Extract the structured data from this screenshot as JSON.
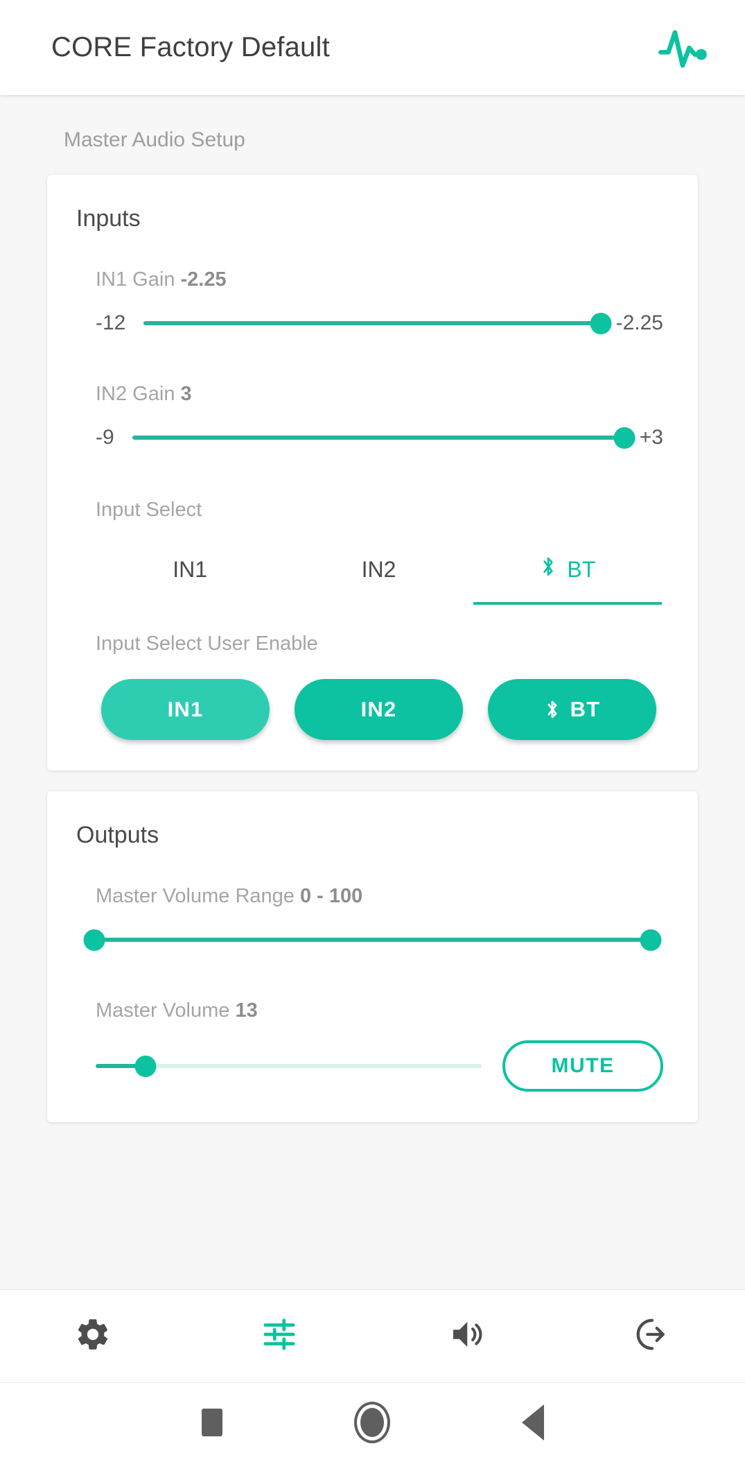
{
  "appbar": {
    "title": "CORE Factory Default",
    "status_icon": "pulse-waveform-icon"
  },
  "page": {
    "section_label": "Master Audio Setup"
  },
  "inputs_card": {
    "title": "Inputs",
    "in1_gain": {
      "label": "IN1 Gain",
      "value": "-2.25",
      "min_label": "-12",
      "max_label": "-2.25",
      "min": -12,
      "max": -2.25,
      "current": -2.25,
      "fill_percent": 100
    },
    "in2_gain": {
      "label": "IN2 Gain",
      "value": "3",
      "min_label": "-9",
      "max_label": "+3",
      "min": -9,
      "max": 3,
      "current": 3,
      "fill_percent": 100
    },
    "input_select": {
      "label": "Input Select",
      "tabs": [
        {
          "label": "IN1",
          "icon": "",
          "active": false
        },
        {
          "label": "IN2",
          "icon": "",
          "active": false
        },
        {
          "label": "BT",
          "icon": "bluetooth-icon",
          "active": true
        }
      ],
      "selected": "BT"
    },
    "input_select_user_enable": {
      "label": "Input Select User Enable",
      "buttons": [
        {
          "label": "IN1",
          "icon": "",
          "highlighted": true
        },
        {
          "label": "IN2",
          "icon": "",
          "highlighted": false
        },
        {
          "label": "BT",
          "icon": "bluetooth-icon",
          "highlighted": false
        }
      ]
    }
  },
  "outputs_card": {
    "title": "Outputs",
    "master_volume_range": {
      "label": "Master Volume Range",
      "value": "0 - 100",
      "min": 0,
      "max": 100,
      "low": 0,
      "high": 100,
      "low_percent": 0,
      "high_percent": 100
    },
    "master_volume": {
      "label": "Master Volume",
      "value": "13",
      "min": 0,
      "max": 100,
      "current": 13,
      "fill_percent": 13,
      "mute_label": "MUTE"
    }
  },
  "bottom_nav": {
    "items": [
      {
        "name": "settings",
        "icon": "gear-icon",
        "active": false
      },
      {
        "name": "tune",
        "icon": "sliders-icon",
        "active": true
      },
      {
        "name": "volume",
        "icon": "speaker-icon",
        "active": false
      },
      {
        "name": "logout",
        "icon": "logout-icon",
        "active": false
      }
    ]
  },
  "system_nav": {
    "items": [
      {
        "name": "recents",
        "icon": "square-icon"
      },
      {
        "name": "home",
        "icon": "circle-icon"
      },
      {
        "name": "back",
        "icon": "triangle-left-icon"
      }
    ]
  },
  "colors": {
    "accent": "#0cc2a0",
    "accent_track": "#22b69d",
    "accent_light": "#2ecdb2",
    "track_inactive": "#d8f2ec",
    "text_dark": "#4a4a4a",
    "text_muted": "#a5a5a5",
    "background": "#f7f7f7"
  }
}
